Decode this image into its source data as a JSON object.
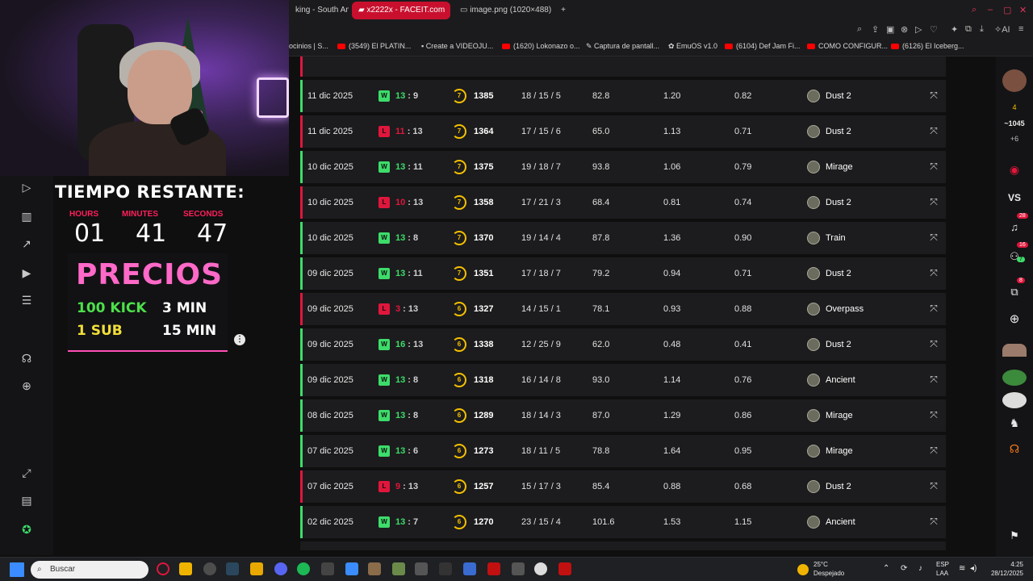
{
  "browser": {
    "tabs": [
      "king - South Am",
      "x2222x - FACEIT.com",
      "image.png (1020×488)"
    ],
    "bookmarks": [
      "ocinios | S...",
      "(3549) El PLATIN...",
      "Create a VIDEOJU...",
      "(1620) Lokonazo o...",
      "Captura de pantall...",
      "EmuOS v1.0",
      "(6104) Def Jam Fi...",
      "COMO CONFIGUR...",
      "(6126) El Iceberg..."
    ],
    "ai_label": "AI"
  },
  "overlay": {
    "timer_title": "TIEMPO RESTANTE:",
    "units": [
      {
        "label": "HOURS",
        "value": "01"
      },
      {
        "label": "MINUTES",
        "value": "41"
      },
      {
        "label": "SECONDS",
        "value": "47"
      }
    ],
    "prices_title": "PRECIOS",
    "prices": [
      {
        "left": "100 KICK",
        "right": "3 MIN",
        "left_color": "#4ce04a"
      },
      {
        "left": "1 SUB",
        "right": "15 MIN",
        "left_color": "#f2df3a"
      }
    ]
  },
  "matches": [
    {
      "date": "11 dic 2025",
      "result": "W",
      "score_a": "13",
      "score_b": "9",
      "level": "7",
      "elo": "1385",
      "kda": "18 / 15 / 5",
      "adr": "82.8",
      "kd": "1.20",
      "kr": "0.82",
      "map": "Dust 2"
    },
    {
      "date": "11 dic 2025",
      "result": "L",
      "score_a": "11",
      "score_b": "13",
      "level": "7",
      "elo": "1364",
      "kda": "17 / 15 / 6",
      "adr": "65.0",
      "kd": "1.13",
      "kr": "0.71",
      "map": "Dust 2"
    },
    {
      "date": "10 dic 2025",
      "result": "W",
      "score_a": "13",
      "score_b": "11",
      "level": "7",
      "elo": "1375",
      "kda": "19 / 18 / 7",
      "adr": "93.8",
      "kd": "1.06",
      "kr": "0.79",
      "map": "Mirage"
    },
    {
      "date": "10 dic 2025",
      "result": "L",
      "score_a": "10",
      "score_b": "13",
      "level": "7",
      "elo": "1358",
      "kda": "17 / 21 / 3",
      "adr": "68.4",
      "kd": "0.81",
      "kr": "0.74",
      "map": "Dust 2"
    },
    {
      "date": "10 dic 2025",
      "result": "W",
      "score_a": "13",
      "score_b": "8",
      "level": "7",
      "elo": "1370",
      "kda": "19 / 14 / 4",
      "adr": "87.8",
      "kd": "1.36",
      "kr": "0.90",
      "map": "Train"
    },
    {
      "date": "09 dic 2025",
      "result": "W",
      "score_a": "13",
      "score_b": "11",
      "level": "7",
      "elo": "1351",
      "kda": "17 / 18 / 7",
      "adr": "79.2",
      "kd": "0.94",
      "kr": "0.71",
      "map": "Dust 2"
    },
    {
      "date": "09 dic 2025",
      "result": "L",
      "score_a": "3",
      "score_b": "13",
      "level": "6",
      "elo": "1327",
      "kda": "14 / 15 / 1",
      "adr": "78.1",
      "kd": "0.93",
      "kr": "0.88",
      "map": "Overpass"
    },
    {
      "date": "09 dic 2025",
      "result": "W",
      "score_a": "16",
      "score_b": "13",
      "level": "6",
      "elo": "1338",
      "kda": "12 / 25 / 9",
      "adr": "62.0",
      "kd": "0.48",
      "kr": "0.41",
      "map": "Dust 2"
    },
    {
      "date": "09 dic 2025",
      "result": "W",
      "score_a": "13",
      "score_b": "8",
      "level": "6",
      "elo": "1318",
      "kda": "16 / 14 / 8",
      "adr": "93.0",
      "kd": "1.14",
      "kr": "0.76",
      "map": "Ancient"
    },
    {
      "date": "08 dic 2025",
      "result": "W",
      "score_a": "13",
      "score_b": "8",
      "level": "6",
      "elo": "1289",
      "kda": "18 / 14 / 3",
      "adr": "87.0",
      "kd": "1.29",
      "kr": "0.86",
      "map": "Mirage"
    },
    {
      "date": "07 dic 2025",
      "result": "W",
      "score_a": "13",
      "score_b": "6",
      "level": "6",
      "elo": "1273",
      "kda": "18 / 11 / 5",
      "adr": "78.8",
      "kd": "1.64",
      "kr": "0.95",
      "map": "Mirage"
    },
    {
      "date": "07 dic 2025",
      "result": "L",
      "score_a": "9",
      "score_b": "13",
      "level": "6",
      "elo": "1257",
      "kda": "15 / 17 / 3",
      "adr": "85.4",
      "kd": "0.88",
      "kr": "0.68",
      "map": "Dust 2"
    },
    {
      "date": "02 dic 2025",
      "result": "W",
      "score_a": "13",
      "score_b": "7",
      "level": "6",
      "elo": "1270",
      "kda": "23 / 15 / 4",
      "adr": "101.6",
      "kd": "1.53",
      "kr": "1.15",
      "map": "Ancient"
    }
  ],
  "colors": {
    "win": "#3ddc6a",
    "loss": "#e0163c",
    "level": "#f5c000"
  },
  "rightbar": {
    "level_badge": "4",
    "elo": "~1045",
    "elo_change": "+6",
    "vs_label": "VS",
    "notif_count": "28",
    "friends_count": "16",
    "friends_online": "7",
    "party_count": "8"
  },
  "taskbar": {
    "search_placeholder": "Buscar",
    "weather_temp": "25°C",
    "weather_desc": "Despejado",
    "lang": "ESP",
    "lang_sub": "LAA",
    "time": "4:25",
    "date": "28/12/2025"
  }
}
